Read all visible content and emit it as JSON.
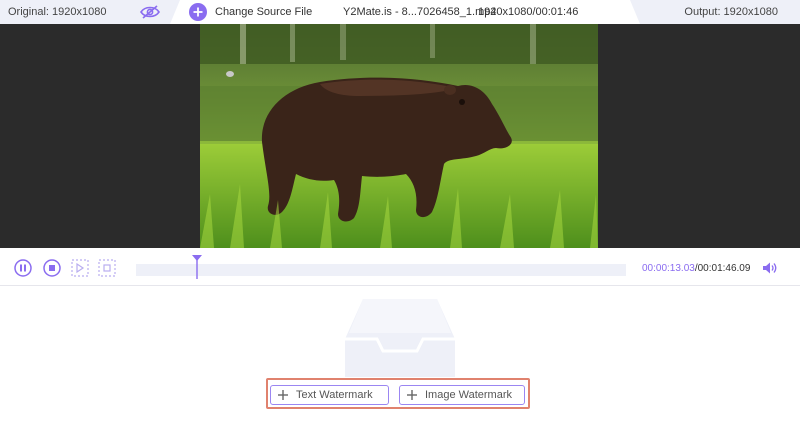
{
  "header": {
    "original_label": "Original: 1920x1080",
    "change_source_label": "Change Source File",
    "file_name": "Y2Mate.is - 8...7026458_1.mp4",
    "file_meta": "1920x1080/00:01:46",
    "output_label": "Output: 1920x1080"
  },
  "player": {
    "current_time": "00:00:13.03",
    "total_time": "/00:01:46.09",
    "progress": 0.125
  },
  "watermark": {
    "text_watermark_label": "Text Watermark",
    "image_watermark_label": "Image Watermark"
  },
  "colors": {
    "accent": "#8a6cf0",
    "tab_bg": "#eef0f8",
    "highlight_border": "#e0826e",
    "video_bg": "#2b2b2b"
  }
}
